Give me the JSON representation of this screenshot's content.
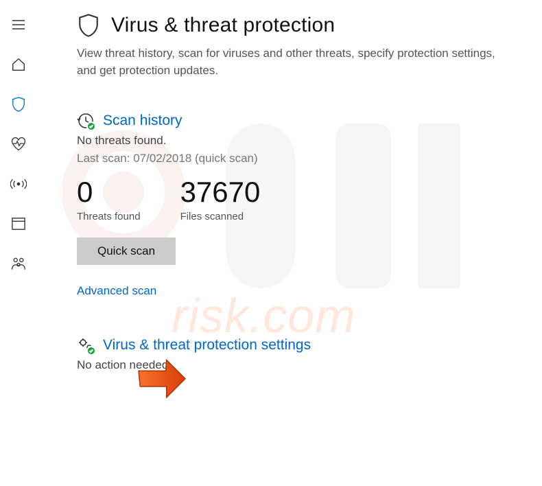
{
  "sidebar": {
    "items": [
      {
        "name": "menu"
      },
      {
        "name": "home"
      },
      {
        "name": "shield"
      },
      {
        "name": "health"
      },
      {
        "name": "network"
      },
      {
        "name": "app-browser"
      },
      {
        "name": "family"
      }
    ]
  },
  "page": {
    "title": "Virus & threat protection",
    "description": "View threat history, scan for viruses and other threats, specify protection settings, and get protection updates."
  },
  "scan": {
    "title": "Scan history",
    "status": "No threats found.",
    "lastScan": "Last scan: 07/02/2018 (quick scan)",
    "threatsValue": "0",
    "threatsLabel": "Threats found",
    "filesValue": "37670",
    "filesLabel": "Files scanned",
    "quickScanLabel": "Quick scan",
    "advancedLabel": "Advanced scan"
  },
  "settings": {
    "title": "Virus & threat protection settings",
    "status": "No action needed."
  },
  "watermark": "risk.com"
}
